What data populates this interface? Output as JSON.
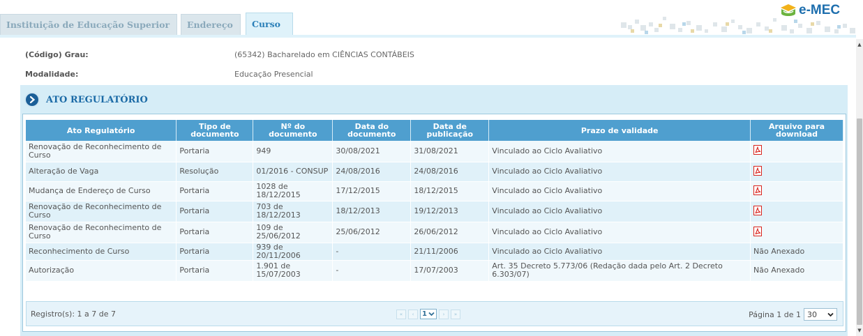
{
  "tabs": [
    {
      "label": "Instituição de Educação Superior",
      "active": false
    },
    {
      "label": "Endereço",
      "active": false
    },
    {
      "label": "Curso",
      "active": true
    }
  ],
  "logo": {
    "text": "e-MEC",
    "icon": "book-logo-icon"
  },
  "course_info": {
    "grau_label": "(Código) Grau:",
    "grau_value": "(65342) Bacharelado em CIÊNCIAS CONTÁBEIS",
    "modalidade_label": "Modalidade:",
    "modalidade_value": "Educação Presencial"
  },
  "section": {
    "title": "ATO REGULATÓRIO",
    "icon": "chevron-right-circle-icon"
  },
  "table": {
    "headers": [
      "Ato Regulatório",
      "Tipo de documento",
      "Nº do documento",
      "Data do documento",
      "Data de publicação",
      "Prazo de validade",
      "Arquivo para download"
    ],
    "rows": [
      {
        "ato": "Renovação de Reconhecimento de Curso",
        "tipo": "Portaria",
        "numero": "949",
        "data_doc": "30/08/2021",
        "data_pub": "31/08/2021",
        "prazo": "Vinculado ao Ciclo Avaliativo",
        "arquivo": "pdf-icon"
      },
      {
        "ato": "Alteração de Vaga",
        "tipo": "Resolução",
        "numero": "01/2016 - CONSUP",
        "data_doc": "24/08/2016",
        "data_pub": "24/08/2016",
        "prazo": "Vinculado ao Ciclo Avaliativo",
        "arquivo": "pdf-icon"
      },
      {
        "ato": "Mudança de Endereço de Curso",
        "tipo": "Portaria",
        "numero": "1028 de 18/12/2015",
        "data_doc": "17/12/2015",
        "data_pub": "18/12/2015",
        "prazo": "Vinculado ao Ciclo Avaliativo",
        "arquivo": "pdf-icon"
      },
      {
        "ato": "Renovação de Reconhecimento de Curso",
        "tipo": "Portaria",
        "numero": "703 de 18/12/2013",
        "data_doc": "18/12/2013",
        "data_pub": "19/12/2013",
        "prazo": "Vinculado ao Ciclo Avaliativo",
        "arquivo": "pdf-icon"
      },
      {
        "ato": "Renovação de Reconhecimento de Curso",
        "tipo": "Portaria",
        "numero": "109 de 25/06/2012",
        "data_doc": "25/06/2012",
        "data_pub": "26/06/2012",
        "prazo": "Vinculado ao Ciclo Avaliativo",
        "arquivo": "pdf-icon"
      },
      {
        "ato": "Reconhecimento de Curso",
        "tipo": "Portaria",
        "numero": "939 de 20/11/2006",
        "data_doc": "-",
        "data_pub": "21/11/2006",
        "prazo": "Vinculado ao Ciclo Avaliativo",
        "arquivo": "Não Anexado"
      },
      {
        "ato": "Autorização",
        "tipo": "Portaria",
        "numero": "1.901 de 15/07/2003",
        "data_doc": "-",
        "data_pub": "17/07/2003",
        "prazo": "Art. 35 Decreto 5.773/06 (Redação dada pelo Art. 2 Decreto 6.303/07)",
        "arquivo": "Não Anexado"
      }
    ]
  },
  "footer": {
    "records": "Registro(s): 1 a 7 de 7",
    "current_page": "1",
    "page_info": "Página 1 de 1",
    "page_size": "30",
    "pager_icons": [
      "first-page-icon",
      "prev-page-icon",
      "next-page-icon",
      "last-page-icon"
    ]
  },
  "colors": {
    "header_bg": "#4f9fcf",
    "section_bg": "#d6edf7",
    "active_tab": "#2a7fb8",
    "row_odd": "#f0f8fc",
    "row_even": "#e0f1f9",
    "pdf_red": "#d9231c"
  }
}
